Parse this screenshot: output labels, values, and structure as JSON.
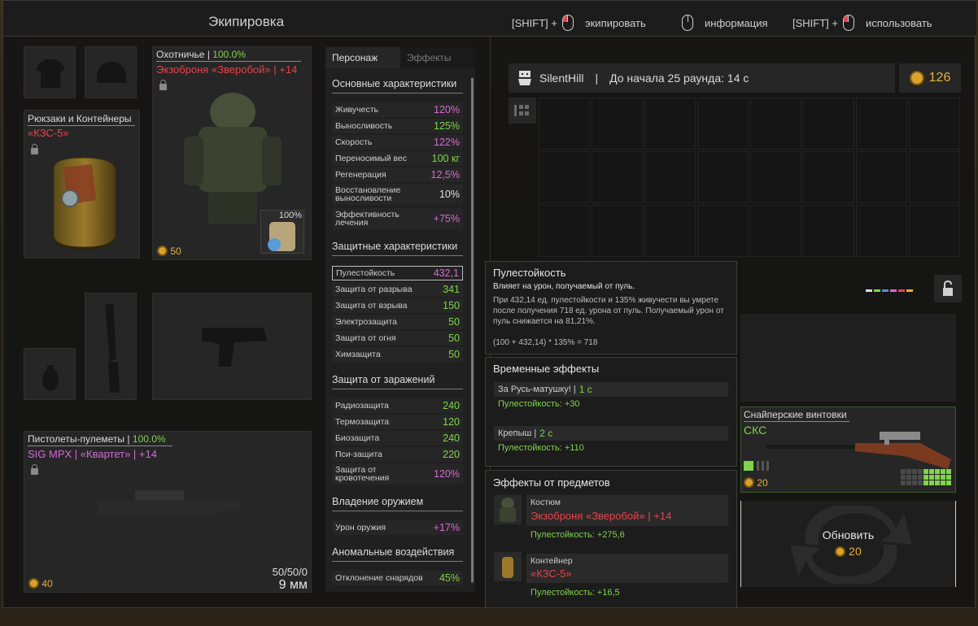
{
  "header": {
    "title": "Экипировка",
    "hints": [
      {
        "prefix": "[SHIFT] +",
        "label": "экипировать"
      },
      {
        "prefix": "",
        "label": "информация"
      },
      {
        "prefix": "[SHIFT] +",
        "label": "использовать"
      }
    ]
  },
  "backpack": {
    "category": "Рюкзаки и Контейнеры",
    "name": "«КЗС-5»"
  },
  "armor": {
    "category": "Охотничье",
    "sep": "|",
    "durability": "100.0%",
    "name": "Экзоброня «Зверобой» | +14",
    "plate_durability": "100%",
    "price": "50"
  },
  "weapon": {
    "category": "Пистолеты-пулеметы",
    "sep": "|",
    "durability": "100.0%",
    "name": "SIG MPX | «Квартет» | +14",
    "price": "40",
    "ammo_count": "50/50/0",
    "caliber": "9 мм"
  },
  "stats_tabs": [
    "Персонаж",
    "Эффекты"
  ],
  "stats": {
    "main_header": "Основные характеристики",
    "main": [
      {
        "k": "Живучесть",
        "v": "120%"
      },
      {
        "k": "Выносливость",
        "v": "125%"
      },
      {
        "k": "Скорость",
        "v": "122%"
      },
      {
        "k": "Переносимый вес",
        "v": "100 кг"
      },
      {
        "k": "Регенерация",
        "v": "12,5%"
      },
      {
        "k": "Восстановление выносливости",
        "v": "10%"
      },
      {
        "k": "Эффективность лечения",
        "v": "+75%"
      }
    ],
    "protect_header": "Защитные характеристики",
    "protect": [
      {
        "k": "Пулестойкость",
        "v": "432,1"
      },
      {
        "k": "Защита от разрыва",
        "v": "341"
      },
      {
        "k": "Защита от взрыва",
        "v": "150"
      },
      {
        "k": "Электрозащита",
        "v": "50"
      },
      {
        "k": "Защита от огня",
        "v": "50"
      },
      {
        "k": "Химзащита",
        "v": "50"
      }
    ],
    "infect_header": "Защита от заражений",
    "infect": [
      {
        "k": "Радиозащита",
        "v": "240"
      },
      {
        "k": "Термозащита",
        "v": "120"
      },
      {
        "k": "Биозащита",
        "v": "240"
      },
      {
        "k": "Пси-защита",
        "v": "220"
      },
      {
        "k": "Защита от кровотечения",
        "v": "120%"
      }
    ],
    "weapon_header": "Владение оружием",
    "weapon": [
      {
        "k": "Урон оружия",
        "v": "+17%"
      }
    ],
    "anomaly_header": "Аномальные воздействия",
    "anomaly": [
      {
        "k": "Отклонение снарядов",
        "v": "45%"
      }
    ]
  },
  "player": {
    "name": "SilentHill",
    "sep": "|",
    "round_text": "До начала 25 раунда: 14 с",
    "money": "126"
  },
  "tooltip": {
    "title": "Пулестойкость",
    "subtitle": "Влияет на урон, получаемый от пуль.",
    "body": "При 432,14 ед. пулестойкости и 135% живучести вы умрете после получения 718 ед. урона от пуль. Получаемый урон от пуль снижается на 81,21%.",
    "formula": "(100 + 432,14) * 135% = 718"
  },
  "temp_effects": {
    "header": "Временные эффекты",
    "items": [
      {
        "name": "За Русь-матушку! |",
        "time": "1 с",
        "bonus": "Пулестойкость: +30"
      },
      {
        "name": "Крепыш |",
        "time": "2 с",
        "bonus": "Пулестойкость: +110"
      }
    ]
  },
  "item_effects": {
    "header": "Эффекты от предметов",
    "items": [
      {
        "type": "Костюм",
        "name": "Экзоброня «Зверобой» | +14",
        "bonus": "Пулестойкость: +275,6"
      },
      {
        "type": "Контейнер",
        "name": "«КЗС-5»",
        "bonus": "Пулестойкость: +16,5"
      }
    ]
  },
  "shop": {
    "sniper_category": "Снайперские винтовки",
    "sniper_name": "СКС",
    "sniper_price": "20",
    "refresh_label": "Обновить",
    "refresh_price": "20"
  },
  "colors": {
    "accent_red": "#e8434a",
    "green": "#7fd54b",
    "pink": "#d36bd6",
    "gold": "#e6b13a"
  }
}
